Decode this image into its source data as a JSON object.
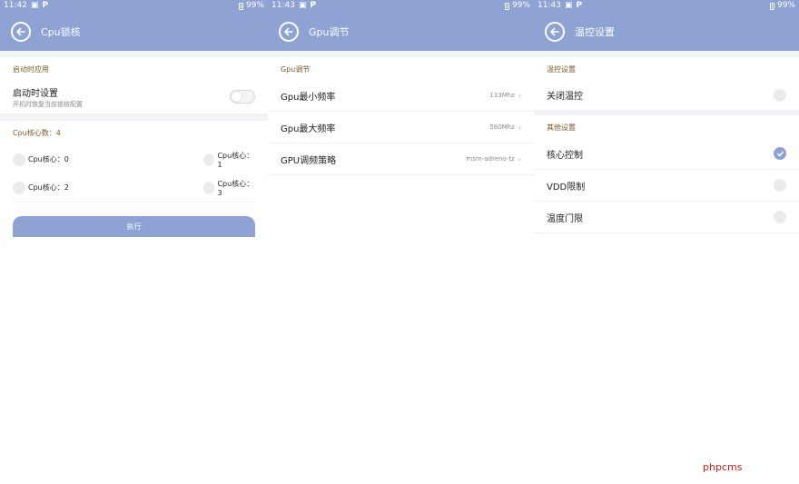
{
  "panels": [
    {
      "status": {
        "time": "11:42",
        "battery": "99%"
      },
      "title": "Cpu锁核",
      "section1": "启动时应用",
      "boot": {
        "label": "启动时设置",
        "desc": "开机时恢复当前锁核配置",
        "enabled": false
      },
      "section2": "Cpu核心数：4",
      "cores": [
        "Cpu核心：0",
        "Cpu核心：1",
        "Cpu核心：2",
        "Cpu核心：3"
      ],
      "button": "执行"
    },
    {
      "status": {
        "time": "11:43",
        "battery": "99%"
      },
      "title": "Gpu调节",
      "section1": "Gpu调节",
      "rows": [
        {
          "label": "Gpu最小频率",
          "value": "133Mhz"
        },
        {
          "label": "Gpu最大频率",
          "value": "560Mhz"
        },
        {
          "label": "GPU调频策略",
          "value": "msm-adreno-tz"
        }
      ]
    },
    {
      "status": {
        "time": "11:43",
        "battery": "99%"
      },
      "title": "温控设置",
      "section1": "温控设置",
      "row1": {
        "label": "关闭温控",
        "checked": false
      },
      "section2": "其他设置",
      "rows": [
        {
          "label": "核心控制",
          "checked": true
        },
        {
          "label": "VDD限制",
          "checked": false
        },
        {
          "label": "温度门限",
          "checked": false
        }
      ]
    }
  ],
  "watermark": "phpcms",
  "colors": {
    "accent": "#8ea3d3",
    "section": "#7a5a2a",
    "watermark": "#d21a1a"
  }
}
